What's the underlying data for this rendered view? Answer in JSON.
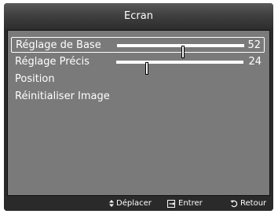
{
  "screen": {
    "title": "Ecran"
  },
  "menu": {
    "items": [
      {
        "label": "Réglage de Base",
        "selected": true,
        "has_slider": true,
        "value": "52",
        "level": 52
      },
      {
        "label": "Réglage Précis",
        "selected": false,
        "has_slider": true,
        "value": "24",
        "level": 24
      },
      {
        "label": "Position",
        "selected": false,
        "has_slider": false
      },
      {
        "label": "Réinitialiser Image",
        "selected": false,
        "has_slider": false
      }
    ]
  },
  "footer": {
    "move_label": "Déplacer",
    "enter_label": "Entrer",
    "return_label": "Retour",
    "move_icon": "up-down-arrows-icon",
    "enter_icon": "enter-icon",
    "return_icon": "return-icon"
  },
  "colors": {
    "panel": "#7a7a7a",
    "frame": "#2a2a2a",
    "text": "#ffffff"
  }
}
